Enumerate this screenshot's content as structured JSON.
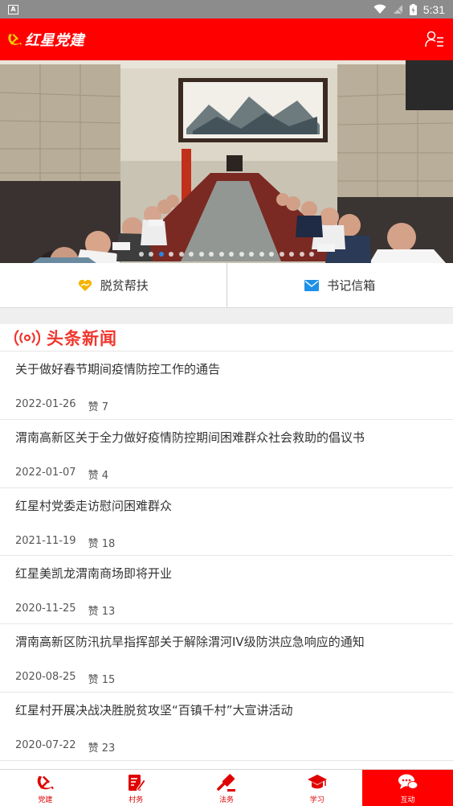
{
  "status_bar": {
    "time": "5:31",
    "app_badge": "A"
  },
  "header": {
    "title": "红星党建",
    "logo_icon": "party-emblem-icon",
    "user_icon": "user-list-icon"
  },
  "banner": {
    "dot_count": 18,
    "active_dot": 2
  },
  "quick_actions": [
    {
      "label": "脱贫帮扶",
      "icon": "handshake-heart-icon"
    },
    {
      "label": "书记信箱",
      "icon": "mail-icon"
    }
  ],
  "headline": {
    "title": "头条新闻",
    "icon": "broadcast-icon"
  },
  "news": [
    {
      "title": "关于做好春节期间疫情防控工作的通告",
      "date": "2022-01-26",
      "likes": "赞 7"
    },
    {
      "title": "渭南高新区关于全力做好疫情防控期间困难群众社会救助的倡议书",
      "date": "2022-01-07",
      "likes": "赞 4"
    },
    {
      "title": "红星村党委走访慰问困难群众",
      "date": "2021-11-19",
      "likes": "赞 18"
    },
    {
      "title": "红星美凯龙渭南商场即将开业",
      "date": "2020-11-25",
      "likes": "赞 13"
    },
    {
      "title": "渭南高新区防汛抗旱指挥部关于解除渭河IV级防洪应急响应的通知",
      "date": "2020-08-25",
      "likes": "赞 15"
    },
    {
      "title": "红星村开展决战决胜脱贫攻坚“百镇千村”大宣讲活动",
      "date": "2020-07-22",
      "likes": "赞 23"
    }
  ],
  "bottom_nav": [
    {
      "label": "党建",
      "icon": "party-emblem-icon",
      "active": false
    },
    {
      "label": "村务",
      "icon": "edit-document-icon",
      "active": false
    },
    {
      "label": "法务",
      "icon": "gavel-icon",
      "active": false
    },
    {
      "label": "学习",
      "icon": "graduation-cap-icon",
      "active": false
    },
    {
      "label": "互动",
      "icon": "chat-bubbles-icon",
      "active": true
    }
  ],
  "colors": {
    "primary_red": "#ff0000",
    "headline_red": "#f0372e",
    "dot_active": "#2a86e0",
    "mail_blue": "#1e90e6",
    "gold": "#f5b400"
  }
}
